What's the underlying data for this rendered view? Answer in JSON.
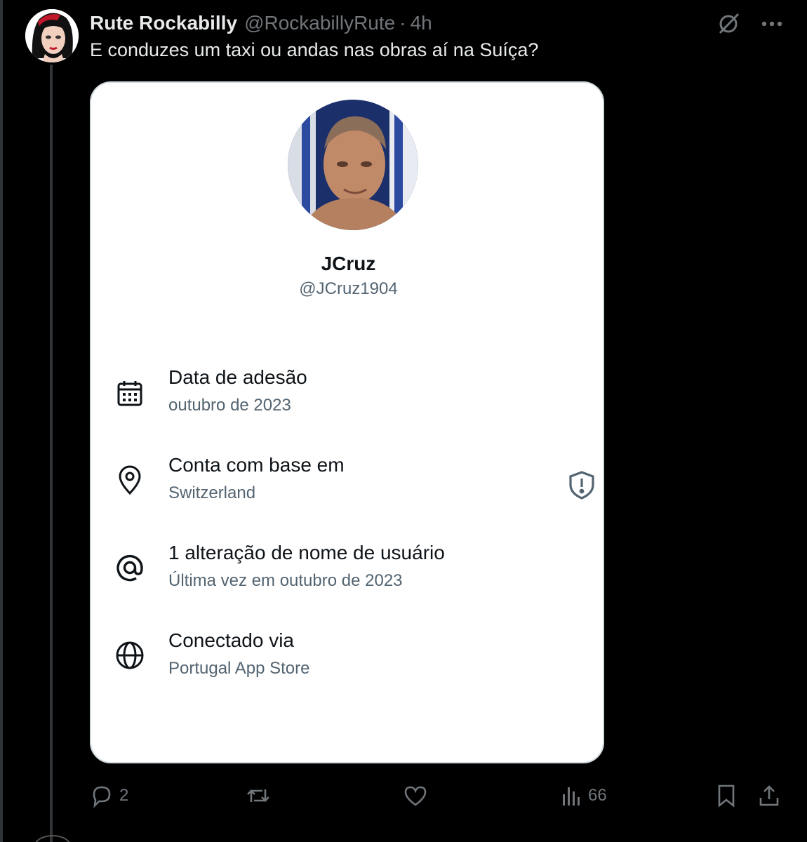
{
  "tweet": {
    "display_name": "Rute Rockabilly",
    "handle": "@RockabillyRute",
    "separator": "·",
    "time": "4h",
    "text": "E conduzes um taxi ou andas nas obras aí na Suíça?"
  },
  "card": {
    "name": "JCruz",
    "handle": "@JCruz1904",
    "rows": [
      {
        "icon": "calendar-icon",
        "title": "Data de adesão",
        "sub": "outubro de 2023"
      },
      {
        "icon": "location-pin-icon",
        "title": "Conta com base em",
        "sub": "Switzerland"
      },
      {
        "icon": "at-sign-icon",
        "title": "1 alteração de nome de usuário",
        "sub": "Última vez em outubro de 2023"
      },
      {
        "icon": "globe-icon",
        "title": "Conectado via",
        "sub": "Portugal App Store"
      }
    ]
  },
  "actions": {
    "replies": "2",
    "views": "66"
  },
  "colors": {
    "background": "#000000",
    "card": "#ffffff",
    "primary_text": "#e7e9ea",
    "secondary_text": "#71767b",
    "card_secondary": "#536471"
  }
}
